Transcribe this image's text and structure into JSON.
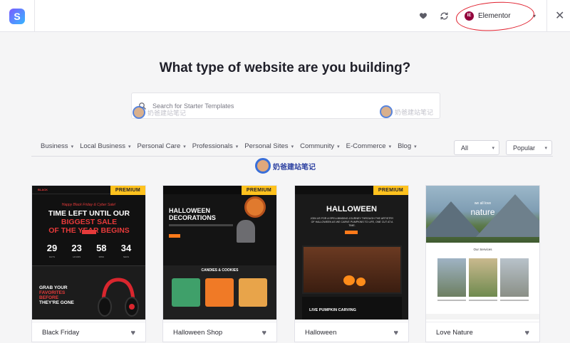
{
  "topbar": {
    "logo_letter": "S",
    "favorites_icon": "heart-icon",
    "sync_icon": "sync-icon",
    "builder_badge": "IE",
    "builder_label": "Elementor",
    "close_icon": "close-icon"
  },
  "heading": "What type of website are you building?",
  "search": {
    "placeholder": "Search for Starter Templates"
  },
  "categories": [
    "Business",
    "Local Business",
    "Personal Care",
    "Professionals",
    "Personal Sites",
    "Community",
    "E-Commerce",
    "Blog"
  ],
  "filters": {
    "type_value": "All",
    "sort_value": "Popular"
  },
  "watermark": {
    "text": "奶爸建站笔记"
  },
  "cards": [
    {
      "name": "Black Friday",
      "badge": "PREMIUM",
      "preview": {
        "nav_logo": "BLACK",
        "script": "Happy Black Friday & Cyber Sale!",
        "headline_white": "TIME LEFT UNTIL OUR ",
        "headline_red1": "BIGGEST SALE",
        "headline_red2": "OF THE YEAR BEGINS",
        "countdown": [
          {
            "value": "29",
            "unit": "DAYS"
          },
          {
            "value": "23",
            "unit": "HOURS"
          },
          {
            "value": "58",
            "unit": "MINS"
          },
          {
            "value": "34",
            "unit": "SECS"
          }
        ],
        "grab_line1": "GRAB YOUR",
        "grab_line2": "FAVORITES BEFORE",
        "grab_line3": "THEY'RE GONE"
      }
    },
    {
      "name": "Halloween Shop",
      "badge": "PREMIUM",
      "preview": {
        "title": "HALLOWEEN DECORATIONS",
        "section": "CANDIES & COOKIES"
      }
    },
    {
      "name": "Halloween",
      "badge": "PREMIUM",
      "preview": {
        "title": "HALLOWEEN",
        "copy": "JOIN US FOR A SPELLBINDING JOURNEY THROUGH THE ARTISTRY OF HALLOWEEN AS WE CARVE PUMPKINS TO LIFE, ONE CUT AT A TIME.",
        "live": "LIVE PUMPKIN CARVING"
      }
    },
    {
      "name": "Love Nature",
      "badge": "",
      "preview": {
        "kicker": "we all love",
        "title": "nature",
        "services": "Our Services"
      }
    }
  ]
}
